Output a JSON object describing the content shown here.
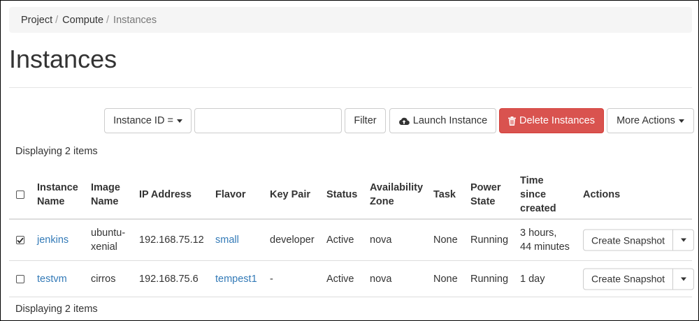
{
  "breadcrumb": {
    "items": [
      "Project",
      "Compute"
    ],
    "separator": "/",
    "current": "Instances"
  },
  "page": {
    "title": "Instances"
  },
  "toolbar": {
    "filter_field": "Instance ID =",
    "filter_value": "",
    "filter_label": "Filter",
    "launch_label": "Launch Instance",
    "delete_label": "Delete Instances",
    "more_label": "More Actions"
  },
  "colors": {
    "danger": "#d9534f",
    "link": "#337ab7",
    "breadcrumb_bg": "#f5f5f5"
  },
  "icons": {
    "launch": "cloud-upload-icon",
    "delete": "trash-icon",
    "dropdown": "caret-down-icon"
  },
  "table": {
    "count_top": "Displaying 2 items",
    "count_bottom": "Displaying 2 items",
    "headers": {
      "name": [
        "Instance",
        "Name"
      ],
      "image": [
        "Image",
        "Name"
      ],
      "ip": "IP Address",
      "flavor": "Flavor",
      "keypair": "Key Pair",
      "status": "Status",
      "zone": [
        "Availability",
        "Zone"
      ],
      "task": "Task",
      "power": [
        "Power",
        "State"
      ],
      "time": [
        "Time",
        "since",
        "created"
      ],
      "actions": "Actions"
    },
    "rows": [
      {
        "selected": true,
        "name": "jenkins",
        "image": [
          "ubuntu-",
          "xenial"
        ],
        "ip": "192.168.75.12",
        "flavor": "small",
        "keypair": "developer",
        "status": "Active",
        "zone": "nova",
        "task": "None",
        "power": "Running",
        "time": [
          "3 hours,",
          "44 minutes"
        ],
        "action": "Create Snapshot"
      },
      {
        "selected": false,
        "name": "testvm",
        "image": [
          "cirros"
        ],
        "ip": "192.168.75.6",
        "flavor": "tempest1",
        "keypair": "-",
        "status": "Active",
        "zone": "nova",
        "task": "None",
        "power": "Running",
        "time": [
          "1 day"
        ],
        "action": "Create Snapshot"
      }
    ]
  }
}
